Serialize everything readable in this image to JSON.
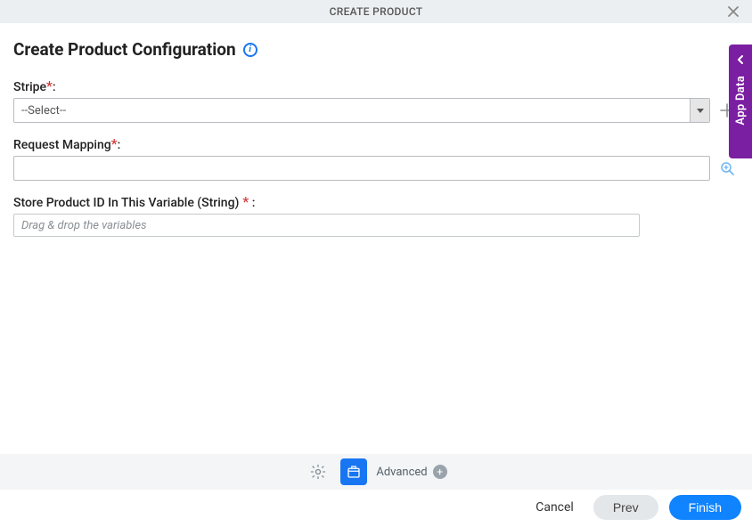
{
  "header": {
    "title": "CREATE PRODUCT"
  },
  "page": {
    "title": "Create Product Configuration"
  },
  "sidebar": {
    "label": "App Data"
  },
  "fields": {
    "stripe": {
      "label": "Stripe",
      "value": "--Select--"
    },
    "request_mapping": {
      "label": "Request Mapping",
      "value": ""
    },
    "store_var": {
      "label": "Store Product ID In This Variable (String)",
      "placeholder": "Drag & drop the variables"
    }
  },
  "toolbar": {
    "advanced": "Advanced"
  },
  "buttons": {
    "cancel": "Cancel",
    "prev": "Prev",
    "finish": "Finish"
  }
}
